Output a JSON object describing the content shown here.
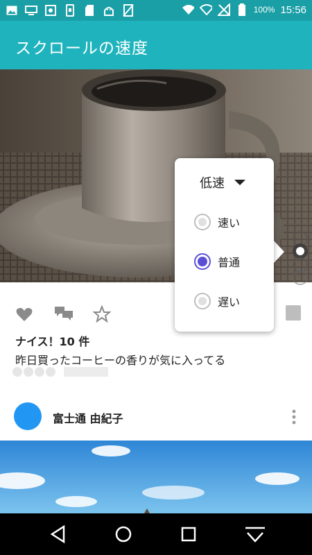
{
  "status_bar": {
    "battery": "100%",
    "time": "15:56",
    "icons_left": [
      "image-icon",
      "monitor-icon",
      "settings-box-icon",
      "phone-icon",
      "sd-card-icon",
      "android-icon",
      "no-sim-icon"
    ],
    "icons_right": [
      "wifi-icon",
      "wifi-icon",
      "no-signal-icon",
      "battery-icon"
    ]
  },
  "app_bar": {
    "title": "スクロールの速度"
  },
  "popup": {
    "current_speed": "低速",
    "options": [
      {
        "label": "速い",
        "selected": false
      },
      {
        "label": "普通",
        "selected": true
      },
      {
        "label": "遅い",
        "selected": false
      }
    ]
  },
  "post": {
    "likes": "ナイス！10 件",
    "caption": "昨日買ったコーヒーの香りが気に入ってる"
  },
  "next_post": {
    "author": "富士通 由紀子"
  },
  "colors": {
    "status_bar": "#1a9fa6",
    "app_bar": "#1fb4bd",
    "avatar": "#2196f3",
    "radio_selected": "#5b4fd6"
  }
}
